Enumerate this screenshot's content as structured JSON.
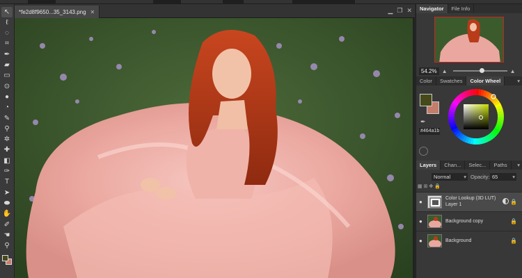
{
  "document": {
    "tab_title": "*fe2d8f9650...35_3143.png",
    "close_glyph": "✕"
  },
  "window_controls": {
    "minimize": "▁",
    "restore": "❐",
    "close": "✕"
  },
  "toolbox": {
    "tools": [
      {
        "name": "move-tool-icon",
        "glyph": "↖"
      },
      {
        "name": "lasso-tool-icon",
        "glyph": "ℓ"
      },
      {
        "name": "quick-select-tool-icon",
        "glyph": "◌"
      },
      {
        "name": "crop-tool-icon",
        "glyph": "⌗"
      },
      {
        "name": "eyedropper-tool-icon",
        "glyph": "✒"
      },
      {
        "name": "eraser-tool-icon",
        "glyph": "▰"
      },
      {
        "name": "rectangle-tool-icon",
        "glyph": "▭"
      },
      {
        "name": "smudge-tool-icon",
        "glyph": "⊙"
      },
      {
        "name": "drop-tool-icon",
        "glyph": "●"
      },
      {
        "name": "dodge-tool-icon",
        "glyph": "◔"
      },
      {
        "name": "brush-tool-icon",
        "glyph": "✎"
      },
      {
        "name": "clone-stamp-tool-icon",
        "glyph": "⚲"
      },
      {
        "name": "warp-tool-icon",
        "glyph": "✲"
      },
      {
        "name": "healing-tool-icon",
        "glyph": "✚"
      },
      {
        "name": "gradient-tool-icon",
        "glyph": "◧"
      },
      {
        "name": "pen-tool-icon",
        "glyph": "✑"
      },
      {
        "name": "type-tool-icon",
        "glyph": "T"
      },
      {
        "name": "path-select-tool-icon",
        "glyph": "➤"
      },
      {
        "name": "shape-tool-icon",
        "glyph": "⬬"
      },
      {
        "name": "hand-tool-icon",
        "glyph": "✋"
      },
      {
        "name": "color-sampler-tool-icon",
        "glyph": "✐"
      },
      {
        "name": "hand-pan-tool-icon",
        "glyph": "☚"
      },
      {
        "name": "zoom-tool-icon",
        "glyph": "⚲"
      }
    ],
    "fg_color": "#464a1b",
    "bg_color": "#c97c6d"
  },
  "navigator": {
    "tabs": [
      "Navigator",
      "File Info"
    ],
    "zoom": "54.2%",
    "zoom_fraction": 0.5
  },
  "color_panel": {
    "tabs": [
      "Color",
      "Swatches",
      "Color Wheel"
    ],
    "hex": "#464a1b",
    "fg": "#464a1b",
    "bg": "#c47c6b",
    "menu_glyph": "▾"
  },
  "layers_panel": {
    "tabs": [
      "Layers",
      "Chan...",
      "Selec...",
      "Paths"
    ],
    "blend_mode": "Normal",
    "opacity_label": "Opacity:",
    "opacity_value": "65",
    "lock_glyphs": "▦ ⊞ ✥ 🔒",
    "layers": [
      {
        "name": "Color Lookup (3D LUT)",
        "sub": "Layer 1",
        "selected": true
      },
      {
        "name": "Background copy",
        "locked": true
      },
      {
        "name": "Background",
        "locked": true
      }
    ]
  }
}
